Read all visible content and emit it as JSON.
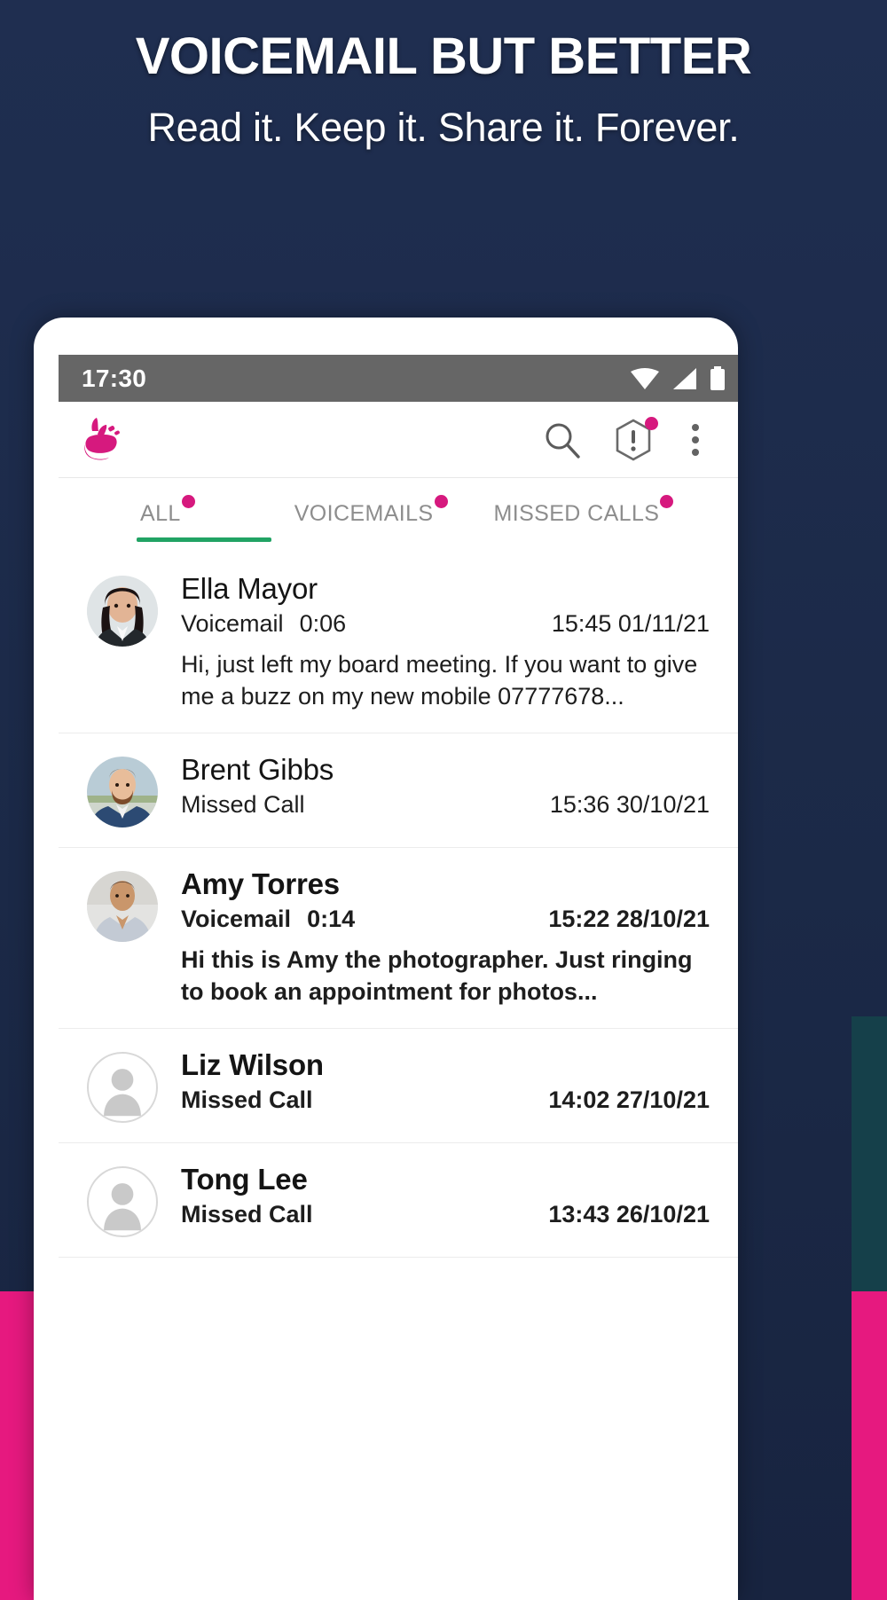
{
  "marketing": {
    "headline": "VOICEMAIL BUT BETTER",
    "subhead": "Read it. Keep it. Share it. Forever.",
    "accent_pink": "#e6197f",
    "background_navy": "#1d2b4c"
  },
  "phone": {
    "statusbar": {
      "time": "17:30",
      "background": "#666666",
      "icons": [
        "wifi-icon",
        "signal-icon",
        "battery-icon"
      ]
    },
    "appbar": {
      "logo": "pointing-hand-logo",
      "actions": [
        {
          "name": "search-icon",
          "badge": false
        },
        {
          "name": "alert-hexagon-icon",
          "badge": true
        },
        {
          "name": "overflow-menu-icon",
          "badge": false
        }
      ]
    },
    "tabs": {
      "active": "ALL",
      "underline_color": "#21a364",
      "badge_color": "#d6197e",
      "items": [
        {
          "label": "ALL",
          "badge": true
        },
        {
          "label": "VOICEMAILS",
          "badge": true
        },
        {
          "label": "MISSED CALLS",
          "badge": true
        }
      ]
    },
    "list": [
      {
        "name": "Ella Mayor",
        "type": "Voicemail",
        "duration": "0:06",
        "time": "15:45 01/11/21",
        "preview": "Hi, just left my board meeting. If you want to give me a buzz on my new mobile 07777678...",
        "unread": false,
        "avatar": "photo-woman-dark-hair"
      },
      {
        "name": "Brent Gibbs",
        "type": "Missed Call",
        "duration": "",
        "time": "15:36 30/10/21",
        "preview": "",
        "unread": false,
        "avatar": "photo-man-beard"
      },
      {
        "name": "Amy Torres",
        "type": "Voicemail",
        "duration": "0:14",
        "time": "15:22 28/10/21",
        "preview": "Hi this is Amy the photographer. Just ringing to book an appointment for photos...",
        "unread": true,
        "avatar": "photo-woman-athletic"
      },
      {
        "name": "Liz Wilson",
        "type": "Missed Call",
        "duration": "",
        "time": "14:02 27/10/21",
        "preview": "",
        "unread": true,
        "avatar": "placeholder-person-icon"
      },
      {
        "name": "Tong Lee",
        "type": "Missed Call",
        "duration": "",
        "time": "13:43 26/10/21",
        "preview": "",
        "unread": true,
        "avatar": "placeholder-person-icon"
      }
    ]
  }
}
